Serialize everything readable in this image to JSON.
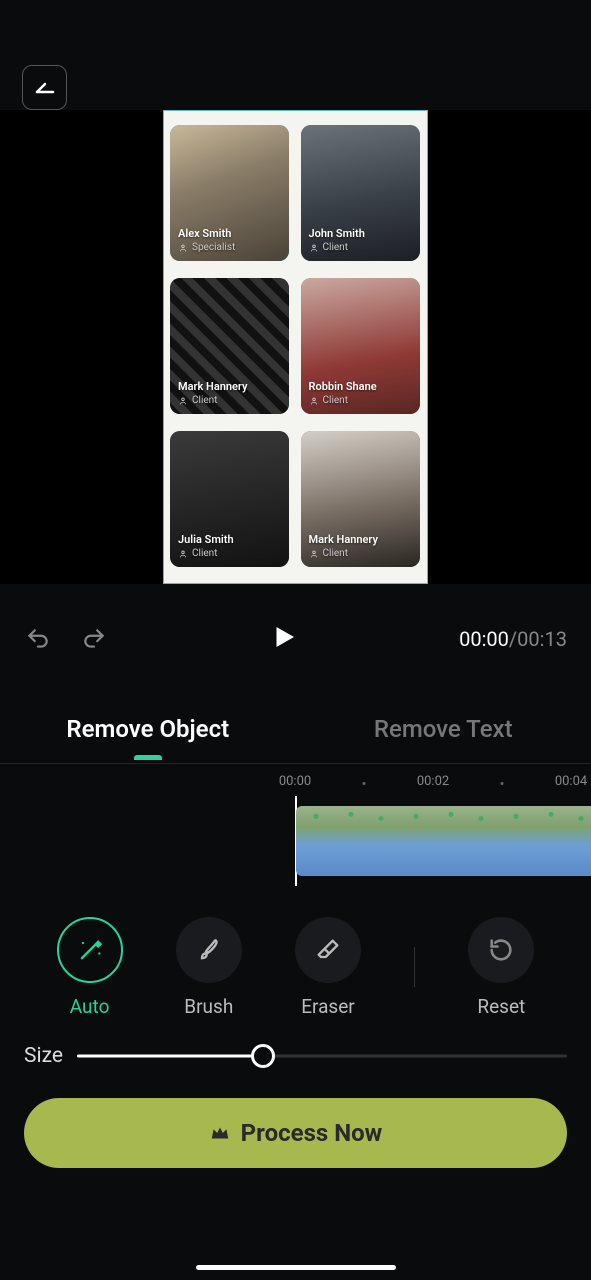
{
  "people": [
    {
      "name": "Alex Smith",
      "role": "Specialist",
      "selected": true,
      "bg": "linear-gradient(160deg,#c9b89a 0%,#8a7d68 40%,#4a4238 100%)"
    },
    {
      "name": "John Smith",
      "role": "Client",
      "selected": false,
      "bg": "linear-gradient(170deg,#6a727a 0%,#3a4048 55%,#1c1f24 100%)"
    },
    {
      "name": "Mark Hannery",
      "role": "Client",
      "selected": false,
      "bg": "repeating-linear-gradient(45deg,#111 0 8px,#333 8px 16px)"
    },
    {
      "name": "Robbin Shane",
      "role": "Client",
      "selected": false,
      "bg": "linear-gradient(170deg,#caa9a1 0%,#8f3a36 60%,#5a2623 100%)"
    },
    {
      "name": "Julia Smith",
      "role": "Client",
      "selected": false,
      "bg": "linear-gradient(170deg,#3a3a3a 0%,#121212 100%)"
    },
    {
      "name": "Mark Hannery",
      "role": "Client",
      "selected": false,
      "bg": "linear-gradient(170deg,#d6cfc7 0%,#7a6f65 55%,#2a2622 100%)"
    }
  ],
  "time": {
    "current": "00:00",
    "duration": "00:13"
  },
  "tabs": {
    "remove_object": "Remove Object",
    "remove_text": "Remove Text"
  },
  "timeline_marks": [
    "00:00",
    "00:02",
    "00:04"
  ],
  "tools": {
    "auto": "Auto",
    "brush": "Brush",
    "eraser": "Eraser",
    "reset": "Reset"
  },
  "size_label": "Size",
  "size_value": 38,
  "process_label": "Process Now"
}
